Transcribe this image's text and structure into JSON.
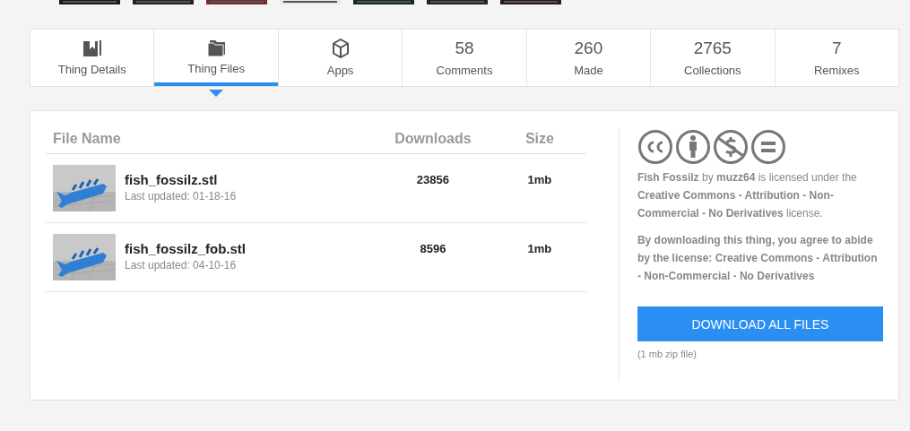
{
  "tabs": [
    {
      "kind": "icon",
      "label": "Thing Details",
      "selected": false
    },
    {
      "kind": "icon",
      "label": "Thing Files",
      "selected": true
    },
    {
      "kind": "icon",
      "label": "Apps",
      "selected": false
    },
    {
      "kind": "count",
      "count": "58",
      "label": "Comments",
      "selected": false
    },
    {
      "kind": "count",
      "count": "260",
      "label": "Made",
      "selected": false
    },
    {
      "kind": "count",
      "count": "2765",
      "label": "Collections",
      "selected": false
    },
    {
      "kind": "count",
      "count": "7",
      "label": "Remixes",
      "selected": false
    }
  ],
  "files_table": {
    "columns": [
      "File Name",
      "Downloads",
      "Size"
    ],
    "rows": [
      {
        "name": "fish_fossilz.stl",
        "updated": "Last updated: 01-18-16",
        "downloads": "23856",
        "size": "1mb"
      },
      {
        "name": "fish_fossilz_fob.stl",
        "updated": "Last updated: 04-10-16",
        "downloads": "8596",
        "size": "1mb"
      }
    ]
  },
  "license": {
    "statement": "**Fish Fossilz** by **muzz64** is licensed under the **Creative Commons - Attribution - Non-Commercial - No Derivatives** license.",
    "agreement": "By downloading this thing, you agree to abide by the license: Creative Commons - Attribution - Non-Commercial - No Derivatives",
    "download_button": "DOWNLOAD ALL FILES",
    "download_note": "(1 mb zip file)"
  }
}
